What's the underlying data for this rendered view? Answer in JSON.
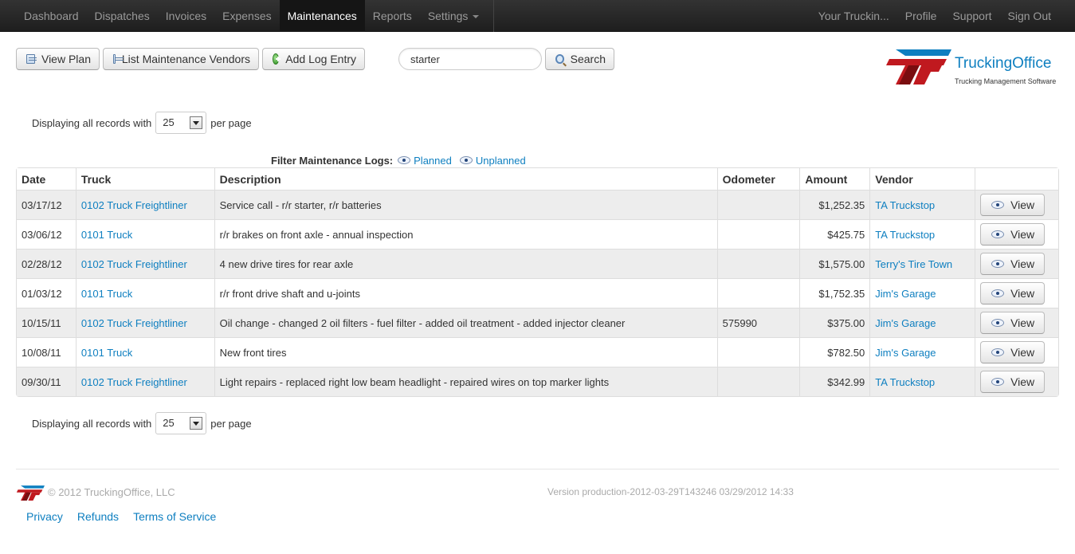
{
  "nav": {
    "left": [
      {
        "label": "Dashboard",
        "active": false
      },
      {
        "label": "Dispatches",
        "active": false
      },
      {
        "label": "Invoices",
        "active": false
      },
      {
        "label": "Expenses",
        "active": false
      },
      {
        "label": "Maintenances",
        "active": true
      },
      {
        "label": "Reports",
        "active": false
      },
      {
        "label": "Settings",
        "active": false
      }
    ],
    "right": [
      "Your Truckin...",
      "Profile",
      "Support",
      "Sign Out"
    ]
  },
  "toolbar": {
    "view_plan": "View Plan",
    "list_vendors": "List Maintenance Vendors",
    "add_log": "Add Log Entry",
    "search_value": "starter",
    "search_button": "Search"
  },
  "logo": {
    "title": "TruckingOffice",
    "subtitle": "Trucking Management Software"
  },
  "pagination": {
    "prefix": "Displaying all records with",
    "per_page": "25",
    "suffix": "per page"
  },
  "filter": {
    "label": "Filter Maintenance Logs:",
    "planned": "Planned",
    "unplanned": "Unplanned"
  },
  "table": {
    "headers": [
      "Date",
      "Truck",
      "Description",
      "Odometer",
      "Amount",
      "Vendor",
      ""
    ],
    "view_label": "View",
    "rows": [
      {
        "date": "03/17/12",
        "truck": "0102 Truck Freightliner",
        "description": "Service call - r/r starter, r/r batteries",
        "odometer": "",
        "amount": "$1,252.35",
        "vendor": "TA Truckstop"
      },
      {
        "date": "03/06/12",
        "truck": "0101 Truck",
        "description": "r/r brakes on front axle - annual inspection",
        "odometer": "",
        "amount": "$425.75",
        "vendor": "TA Truckstop"
      },
      {
        "date": "02/28/12",
        "truck": "0102 Truck Freightliner",
        "description": "4 new drive tires for rear axle",
        "odometer": "",
        "amount": "$1,575.00",
        "vendor": "Terry's Tire Town"
      },
      {
        "date": "01/03/12",
        "truck": "0101 Truck",
        "description": "r/r front drive shaft and u-joints",
        "odometer": "",
        "amount": "$1,752.35",
        "vendor": "Jim's Garage"
      },
      {
        "date": "10/15/11",
        "truck": "0102 Truck Freightliner",
        "description": "Oil change - changed 2 oil filters - fuel filter - added oil treatment - added injector cleaner",
        "odometer": "575990",
        "amount": "$375.00",
        "vendor": "Jim's Garage"
      },
      {
        "date": "10/08/11",
        "truck": "0101 Truck",
        "description": "New front tires",
        "odometer": "",
        "amount": "$782.50",
        "vendor": "Jim's Garage"
      },
      {
        "date": "09/30/11",
        "truck": "0102 Truck Freightliner",
        "description": "Light repairs - replaced right low beam headlight - repaired wires on top marker lights",
        "odometer": "",
        "amount": "$342.99",
        "vendor": "TA Truckstop"
      }
    ]
  },
  "footer": {
    "copyright": "© 2012 TruckingOffice, LLC",
    "version": "Version production-2012-03-29T143246 03/29/2012 14:33",
    "links": [
      "Privacy",
      "Refunds",
      "Terms of Service"
    ]
  },
  "colors": {
    "link": "#0e7fc0",
    "logo_red": "#c0191f",
    "logo_dark_red": "#7a0d10",
    "logo_blue": "#0e7fc0"
  }
}
